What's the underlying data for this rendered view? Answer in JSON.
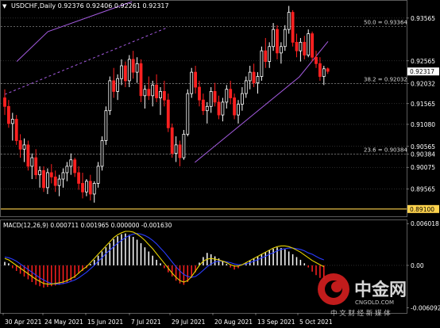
{
  "header": {
    "symbol_line": "USDCHF,Daily  0.92376 0.92406 0.92261 0.92317",
    "dropdown_glyph": "▼"
  },
  "macd": {
    "label": "MACD(12,26,9) 0.000711 0.001965 0.000000 -0.001630"
  },
  "watermark": {
    "logo_text": "中金网",
    "domain": "CNGOLD.COM",
    "slogan": "中 文 财 经 新 媒 体"
  },
  "colors": {
    "background": "#000000",
    "grid": "#5a5a5a",
    "bull": "#ffffff",
    "bear": "#ff2020",
    "channel": "#a45be0",
    "current_price_tag": "#ffffff",
    "support_tag": "#ffd34d",
    "macd_line": "#e6d200",
    "signal_line": "#2a3cff",
    "hist_pos": "#ffffff",
    "hist_neg": "#ff2020",
    "watermark_red": "#d21f1f"
  },
  "chart_data": [
    {
      "type": "candlestick",
      "title": "USDCHF,Daily",
      "ohlc_last": {
        "open": 0.92376,
        "high": 0.92406,
        "low": 0.92261,
        "close": 0.92317
      },
      "x": [
        "30 Apr 2021",
        "24 May 2021",
        "15 Jun 2021",
        "7 Jul 2021",
        "29 Jul 2021",
        "20 Aug 2021",
        "13 Sep 2021",
        "5 Oct 2021"
      ],
      "y_ticks": [
        0.93565,
        0.92565,
        0.92317,
        0.92032,
        0.91565,
        0.9108,
        0.90565,
        0.90384,
        0.90075,
        0.89565,
        0.891
      ],
      "ylim": [
        0.8893,
        0.9397
      ],
      "levels": [
        {
          "label": "50.0 = 0.93364",
          "value": 0.93364
        },
        {
          "label": "38.2 = 0.92032",
          "value": 0.92032
        },
        {
          "label": "23.6 = 0.90384",
          "value": 0.90384
        }
      ],
      "price_tags": [
        {
          "label": "0.92317",
          "value": 0.92317,
          "style": "current"
        },
        {
          "label": "0.89100",
          "value": 0.891,
          "style": "support"
        }
      ],
      "channel": {
        "upper": [
          [
            0.25,
            0.9255
          ],
          [
            0.9,
            0.9325
          ],
          [
            2.7,
            0.9395
          ]
        ],
        "lower": [
          [
            4.1,
            0.9019
          ],
          [
            6.4,
            0.9219
          ],
          [
            7.5,
            0.9302
          ]
        ],
        "dashed": [
          [
            0.0,
            0.9178
          ],
          [
            3.5,
            0.9335
          ]
        ]
      },
      "candles": [
        [
          0.917,
          0.919,
          0.913,
          0.915
        ],
        [
          0.915,
          0.9165,
          0.91,
          0.911
        ],
        [
          0.911,
          0.9135,
          0.907,
          0.912
        ],
        [
          0.912,
          0.913,
          0.906,
          0.907
        ],
        [
          0.907,
          0.9085,
          0.903,
          0.905
        ],
        [
          0.905,
          0.9075,
          0.902,
          0.906
        ],
        [
          0.906,
          0.907,
          0.9,
          0.901
        ],
        [
          0.901,
          0.904,
          0.898,
          0.903
        ],
        [
          0.903,
          0.905,
          0.898,
          0.899
        ],
        [
          0.899,
          0.901,
          0.896,
          0.9
        ],
        [
          0.9,
          0.901,
          0.895,
          0.896
        ],
        [
          0.896,
          0.9005,
          0.8945,
          0.8995
        ],
        [
          0.8995,
          0.9015,
          0.897,
          0.8985
        ],
        [
          0.8985,
          0.9,
          0.895,
          0.8965
        ],
        [
          0.8965,
          0.899,
          0.894,
          0.898
        ],
        [
          0.898,
          0.9005,
          0.896,
          0.8995
        ],
        [
          0.8995,
          0.902,
          0.8975,
          0.901
        ],
        [
          0.901,
          0.904,
          0.899,
          0.9025
        ],
        [
          0.9025,
          0.903,
          0.8985,
          0.8995
        ],
        [
          0.8995,
          0.901,
          0.8955,
          0.897
        ],
        [
          0.897,
          0.8995,
          0.8935,
          0.895
        ],
        [
          0.895,
          0.898,
          0.894,
          0.8975
        ],
        [
          0.8975,
          0.899,
          0.893,
          0.8945
        ],
        [
          0.8945,
          0.8975,
          0.8925,
          0.897
        ],
        [
          0.897,
          0.902,
          0.896,
          0.901
        ],
        [
          0.901,
          0.908,
          0.9,
          0.907
        ],
        [
          0.907,
          0.915,
          0.906,
          0.914
        ],
        [
          0.914,
          0.922,
          0.913,
          0.921
        ],
        [
          0.921,
          0.924,
          0.917,
          0.9185
        ],
        [
          0.9185,
          0.9225,
          0.9165,
          0.9215
        ],
        [
          0.9215,
          0.926,
          0.92,
          0.9245
        ],
        [
          0.9245,
          0.9255,
          0.9195,
          0.921
        ],
        [
          0.921,
          0.927,
          0.9195,
          0.926
        ],
        [
          0.926,
          0.928,
          0.9215,
          0.923
        ],
        [
          0.923,
          0.9265,
          0.9205,
          0.925
        ],
        [
          0.925,
          0.926,
          0.916,
          0.9175
        ],
        [
          0.9175,
          0.92,
          0.9145,
          0.919
        ],
        [
          0.919,
          0.922,
          0.9165,
          0.9175
        ],
        [
          0.9175,
          0.921,
          0.915,
          0.92
        ],
        [
          0.92,
          0.9225,
          0.916,
          0.917
        ],
        [
          0.917,
          0.9195,
          0.913,
          0.9185
        ],
        [
          0.9185,
          0.921,
          0.915,
          0.9165
        ],
        [
          0.9165,
          0.918,
          0.909,
          0.91
        ],
        [
          0.91,
          0.911,
          0.903,
          0.904
        ],
        [
          0.904,
          0.908,
          0.902,
          0.906
        ],
        [
          0.906,
          0.907,
          0.901,
          0.903
        ],
        [
          0.903,
          0.9095,
          0.9025,
          0.9085
        ],
        [
          0.9085,
          0.919,
          0.908,
          0.918
        ],
        [
          0.918,
          0.924,
          0.917,
          0.923
        ],
        [
          0.923,
          0.9245,
          0.918,
          0.9195
        ],
        [
          0.9195,
          0.921,
          0.915,
          0.9165
        ],
        [
          0.9165,
          0.918,
          0.913,
          0.914
        ],
        [
          0.914,
          0.916,
          0.911,
          0.915
        ],
        [
          0.915,
          0.9195,
          0.9135,
          0.9185
        ],
        [
          0.9185,
          0.9205,
          0.915,
          0.916
        ],
        [
          0.916,
          0.9175,
          0.912,
          0.913
        ],
        [
          0.913,
          0.917,
          0.9115,
          0.916
        ],
        [
          0.916,
          0.92,
          0.9145,
          0.919
        ],
        [
          0.919,
          0.921,
          0.9155,
          0.917
        ],
        [
          0.917,
          0.918,
          0.912,
          0.913
        ],
        [
          0.913,
          0.9165,
          0.911,
          0.9155
        ],
        [
          0.9155,
          0.9195,
          0.914,
          0.918
        ],
        [
          0.918,
          0.922,
          0.917,
          0.921
        ],
        [
          0.921,
          0.9245,
          0.919,
          0.923
        ],
        [
          0.923,
          0.925,
          0.9195,
          0.9205
        ],
        [
          0.9205,
          0.923,
          0.918,
          0.922
        ],
        [
          0.922,
          0.929,
          0.921,
          0.928
        ],
        [
          0.928,
          0.931,
          0.924,
          0.9255
        ],
        [
          0.9255,
          0.93,
          0.924,
          0.929
        ],
        [
          0.929,
          0.9345,
          0.928,
          0.933
        ],
        [
          0.933,
          0.934,
          0.926,
          0.9275
        ],
        [
          0.9275,
          0.93,
          0.925,
          0.929
        ],
        [
          0.929,
          0.934,
          0.928,
          0.933
        ],
        [
          0.933,
          0.9385,
          0.932,
          0.937
        ],
        [
          0.937,
          0.9375,
          0.929,
          0.93
        ],
        [
          0.93,
          0.932,
          0.9265,
          0.928
        ],
        [
          0.928,
          0.931,
          0.9255,
          0.93
        ],
        [
          0.93,
          0.9315,
          0.926,
          0.927
        ],
        [
          0.927,
          0.933,
          0.9265,
          0.932
        ],
        [
          0.932,
          0.9325,
          0.9255,
          0.9265
        ],
        [
          0.9265,
          0.928,
          0.924,
          0.925
        ],
        [
          0.925,
          0.9265,
          0.921,
          0.922
        ],
        [
          0.922,
          0.9245,
          0.92,
          0.9238
        ],
        [
          0.9238,
          0.9241,
          0.9226,
          0.9232
        ]
      ]
    },
    {
      "type": "bar",
      "title": "MACD(12,26,9)",
      "ylim": [
        -0.00685,
        0.0065
      ],
      "y_ticks": [
        0.006018,
        0.0,
        -0.006092
      ],
      "histogram": [
        0.0005,
        0.0003,
        -0.0004,
        -0.0008,
        -0.0012,
        -0.0016,
        -0.002,
        -0.0024,
        -0.0028,
        -0.003,
        -0.0032,
        -0.0031,
        -0.003,
        -0.0029,
        -0.0028,
        -0.0027,
        -0.0025,
        -0.0022,
        -0.0018,
        -0.0012,
        -0.0008,
        -0.0004,
        0.0002,
        0.0008,
        0.0014,
        0.002,
        0.0026,
        0.0032,
        0.0038,
        0.0042,
        0.0045,
        0.0046,
        0.0044,
        0.0041,
        0.0037,
        0.0032,
        0.0026,
        0.002,
        0.0014,
        0.0008,
        0.0003,
        -0.0004,
        -0.001,
        -0.0016,
        -0.0022,
        -0.0026,
        -0.0028,
        -0.0024,
        -0.0018,
        -0.001,
        0.0004,
        0.0012,
        0.0018,
        0.0016,
        0.0013,
        0.001,
        0.0006,
        0.0002,
        -0.0003,
        -0.0006,
        -0.0004,
        0.0,
        0.0004,
        0.0007,
        0.001,
        0.0013,
        0.0016,
        0.0019,
        0.0022,
        0.0024,
        0.0026,
        0.0025,
        0.0023,
        0.002,
        0.0016,
        0.0012,
        0.0008,
        0.0003,
        -0.0003,
        -0.0009,
        -0.0014,
        -0.0018,
        -0.002
      ],
      "macd_line": [
        0.001,
        0.0008,
        0.0004,
        0.0,
        -0.0004,
        -0.0008,
        -0.0012,
        -0.0016,
        -0.002,
        -0.0023,
        -0.0026,
        -0.0027,
        -0.0027,
        -0.0026,
        -0.0025,
        -0.0024,
        -0.0022,
        -0.0019,
        -0.0016,
        -0.0011,
        -0.0006,
        -0.0002,
        0.0004,
        0.001,
        0.0016,
        0.0022,
        0.0028,
        0.0034,
        0.004,
        0.0044,
        0.0047,
        0.0049,
        0.0049,
        0.0048,
        0.0045,
        0.0041,
        0.0036,
        0.003,
        0.0024,
        0.0017,
        0.001,
        0.0003,
        -0.0004,
        -0.0011,
        -0.0017,
        -0.0022,
        -0.0024,
        -0.0022,
        -0.0016,
        -0.0008,
        0.0,
        0.0006,
        0.0009,
        0.001,
        0.0009,
        0.0008,
        0.0006,
        0.0004,
        0.0001,
        -0.0001,
        -0.0001,
        0.0001,
        0.0004,
        0.0007,
        0.001,
        0.0013,
        0.0016,
        0.0019,
        0.0022,
        0.0025,
        0.0027,
        0.0028,
        0.0028,
        0.0027,
        0.0025,
        0.0022,
        0.0019,
        0.0015,
        0.0011,
        0.0007,
        0.0004,
        0.0001,
        -0.0002
      ],
      "signal_line": [
        0.0012,
        0.0011,
        0.0009,
        0.0006,
        0.0002,
        -0.0002,
        -0.0006,
        -0.001,
        -0.0014,
        -0.0018,
        -0.0021,
        -0.0024,
        -0.0026,
        -0.0027,
        -0.0027,
        -0.0026,
        -0.0025,
        -0.0023,
        -0.0021,
        -0.0018,
        -0.0014,
        -0.001,
        -0.0005,
        0.0,
        0.0006,
        0.0011,
        0.0017,
        0.0022,
        0.0027,
        0.0032,
        0.0036,
        0.004,
        0.0043,
        0.0045,
        0.0046,
        0.0045,
        0.0043,
        0.004,
        0.0036,
        0.0031,
        0.0025,
        0.0019,
        0.0012,
        0.0005,
        -0.0002,
        -0.0008,
        -0.0013,
        -0.0016,
        -0.0017,
        -0.0016,
        -0.0012,
        -0.0007,
        -0.0002,
        0.0002,
        0.0005,
        0.0006,
        0.0006,
        0.0005,
        0.0004,
        0.0002,
        0.0001,
        0.0001,
        0.0002,
        0.0004,
        0.0006,
        0.0008,
        0.0011,
        0.0013,
        0.0016,
        0.0018,
        0.0021,
        0.0023,
        0.0024,
        0.0025,
        0.0025,
        0.0024,
        0.0023,
        0.0021,
        0.0018,
        0.0016,
        0.0013,
        0.001,
        0.0008
      ]
    }
  ]
}
